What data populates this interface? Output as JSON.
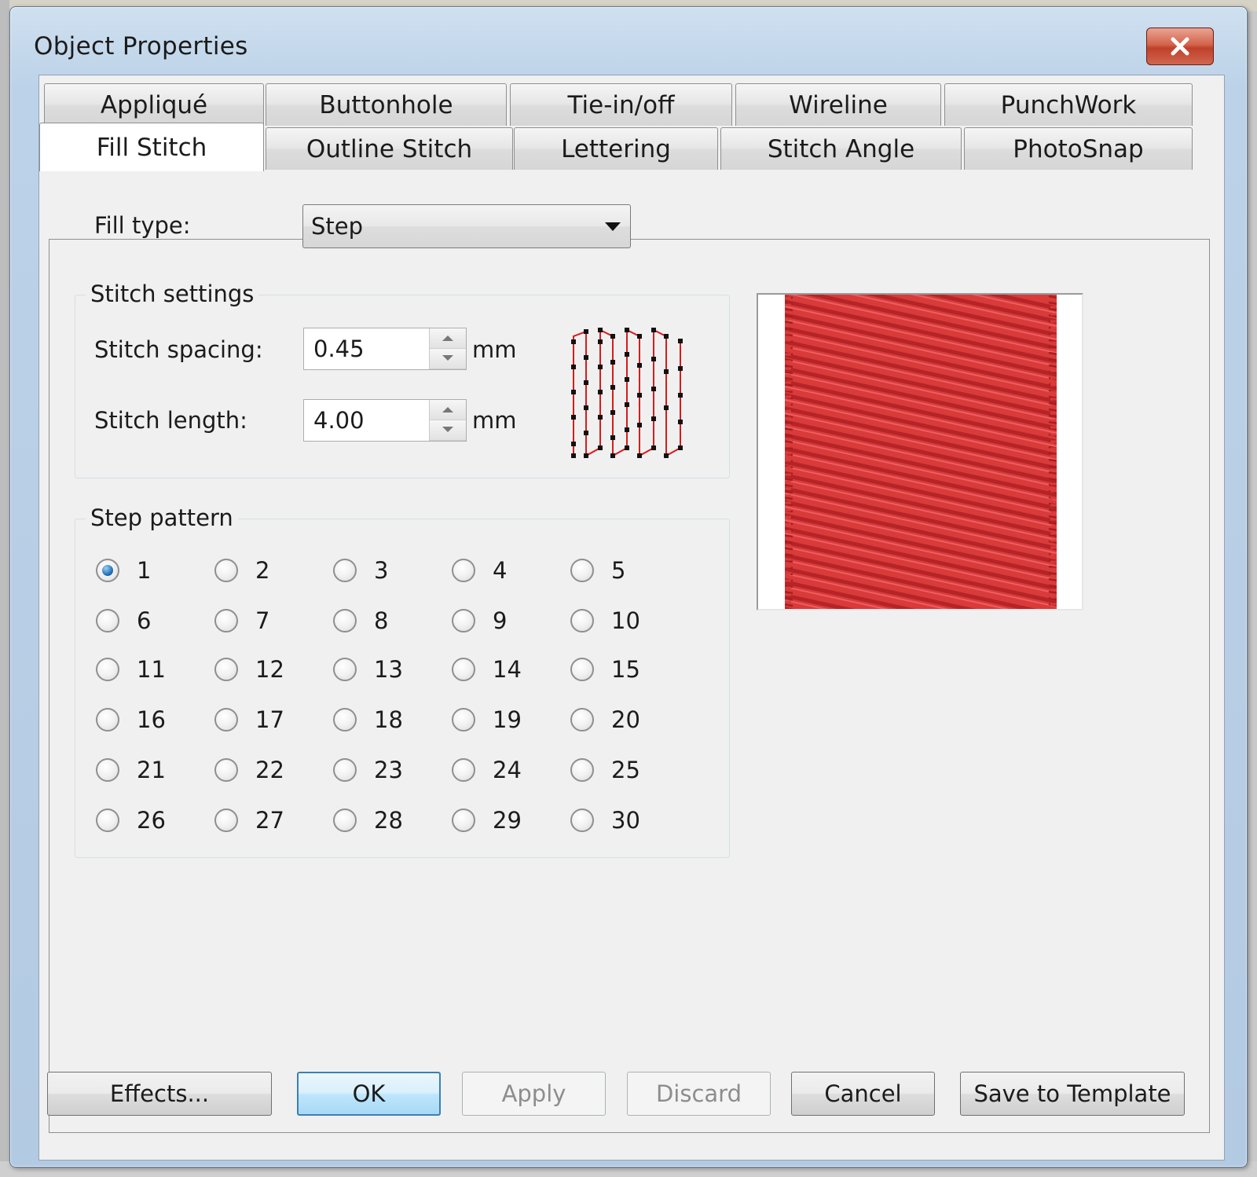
{
  "window": {
    "title": "Object Properties"
  },
  "tabs": {
    "row_back": [
      "Appliqué",
      "Buttonhole",
      "Tie-in/off",
      "Wireline",
      "PunchWork"
    ],
    "row_front": [
      "Fill Stitch",
      "Outline Stitch",
      "Lettering",
      "Stitch Angle",
      "PhotoSnap"
    ],
    "active": "Fill Stitch"
  },
  "fill_type": {
    "label": "Fill type:",
    "value": "Step"
  },
  "stitch_settings": {
    "title": "Stitch settings",
    "spacing": {
      "label": "Stitch spacing:",
      "value": "0.45",
      "unit": "mm"
    },
    "length": {
      "label": "Stitch length:",
      "value": "4.00",
      "unit": "mm"
    }
  },
  "step_pattern": {
    "title": "Step pattern",
    "options": [
      "1",
      "2",
      "3",
      "4",
      "5",
      "6",
      "7",
      "8",
      "9",
      "10",
      "11",
      "12",
      "13",
      "14",
      "15",
      "16",
      "17",
      "18",
      "19",
      "20",
      "21",
      "22",
      "23",
      "24",
      "25",
      "26",
      "27",
      "28",
      "29",
      "30"
    ],
    "selected": "1"
  },
  "buttons": {
    "effects": "Effects...",
    "ok": "OK",
    "apply": "Apply",
    "discard": "Discard",
    "cancel": "Cancel",
    "save_template": "Save to Template"
  },
  "colors": {
    "stitch_red": "#d93a3a",
    "stitch_dark": "#a81e22",
    "accent_blue": "#3c7fb1"
  }
}
